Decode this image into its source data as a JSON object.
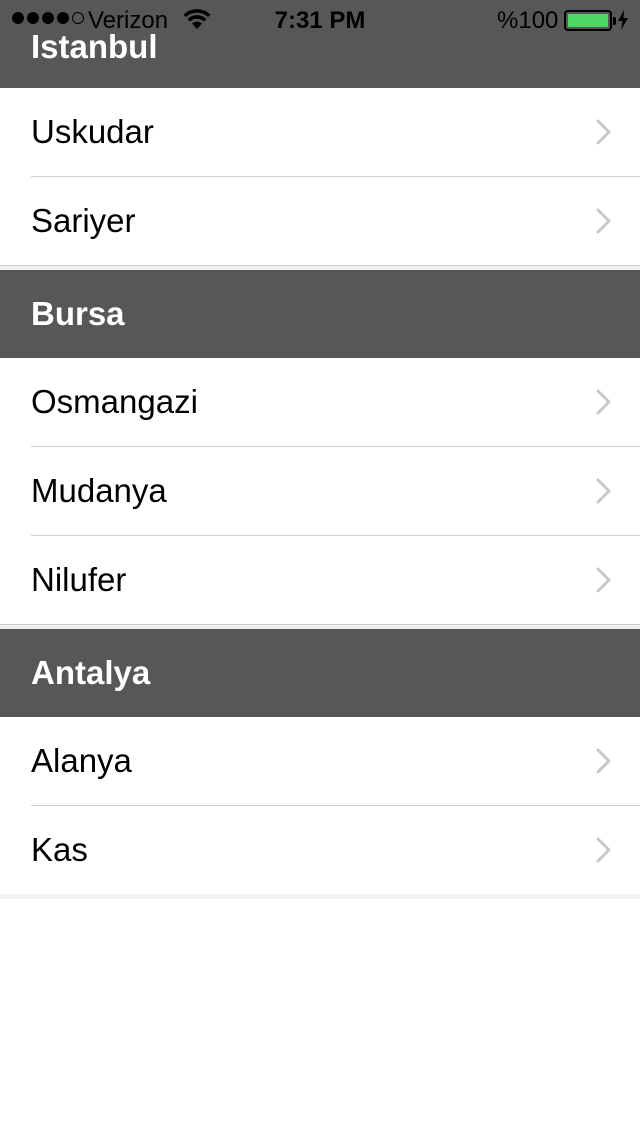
{
  "status_bar": {
    "carrier": "Verizon",
    "time": "7:31 PM",
    "battery_percent": "%100",
    "battery_level": 1.0,
    "signal_bars_filled": 4,
    "signal_bars_total": 5,
    "icons": [
      "signal-dots",
      "wifi-icon",
      "battery-icon",
      "charging-bolt-icon"
    ]
  },
  "sections": [
    {
      "title": "Istanbul",
      "rows": [
        "Uskudar",
        "Sariyer"
      ]
    },
    {
      "title": "Bursa",
      "rows": [
        "Osmangazi",
        "Mudanya",
        "Nilufer"
      ]
    },
    {
      "title": "Antalya",
      "rows": [
        "Alanya",
        "Kas"
      ]
    }
  ],
  "colors": {
    "section_header_bg": "#575757",
    "section_header_text": "#ffffff",
    "chevron": "#c7c7cc",
    "battery_fill": "#4cd964"
  }
}
